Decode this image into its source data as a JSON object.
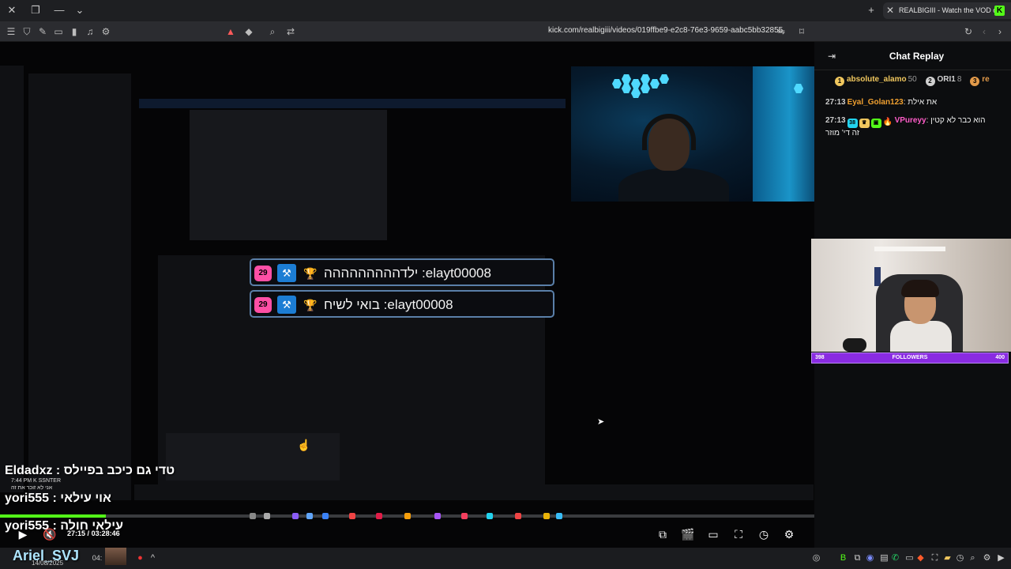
{
  "browser": {
    "tab_title": "REALBIGIII - Watch the VOD on Kick",
    "tab_favicon": "K",
    "url": "kick.com/realbigiii/videos/019ffbe9-e2c8-76e3-9659-aabc5bb32855"
  },
  "overlay_chat": [
    {
      "sub_months": "29",
      "text": "elayt00008: ילדההההההההה"
    },
    {
      "sub_months": "29",
      "text": "elayt00008: בואי לשיח"
    }
  ],
  "bottom_overlay": {
    "line1": "Eldadxz : טדי גם כיכב בפיילס",
    "small1": "7:44 PM   K   SSNTER",
    "small2": "אני לא זוכר את זה",
    "line2": "yori555 : אוי עילאי",
    "line3": "yori555 : עילאי חולה"
  },
  "player": {
    "current_time": "27:15",
    "separator": "/",
    "duration": "03:28:46",
    "progress_fraction": 0.13
  },
  "chat": {
    "title": "Chat Replay",
    "leaderboard": [
      {
        "rank": "1",
        "name": "absolute_alamo",
        "points": "50",
        "color": "#f0c75e"
      },
      {
        "rank": "2",
        "name": "ORI1",
        "points": "8",
        "color": "#d0d0d0"
      },
      {
        "rank": "3",
        "name": "re",
        "points": "",
        "color": "#e29a4a"
      }
    ],
    "messages": [
      {
        "time": "27:13",
        "user": "Eyal_Golan123",
        "text": "את אילת"
      },
      {
        "time": "27:13",
        "badge": "38",
        "user": "VPureyy",
        "text": "הוא כבר לא קטין",
        "text2": "זה די' מוזר"
      }
    ]
  },
  "followers_goal": {
    "current": "398",
    "label": "FOLLOWERS",
    "target": "400",
    "fill_fraction": 0.995
  },
  "taskbar": {
    "overlay_name": "Ariel_SVJ",
    "time_fragment": "04:",
    "date": "14/08/2025"
  },
  "colors": {
    "kick_green": "#53fc18",
    "sub_badge": "#ff4fa5",
    "mod_badge": "#1c7dd4",
    "followers_bar": "#8a2be2"
  }
}
